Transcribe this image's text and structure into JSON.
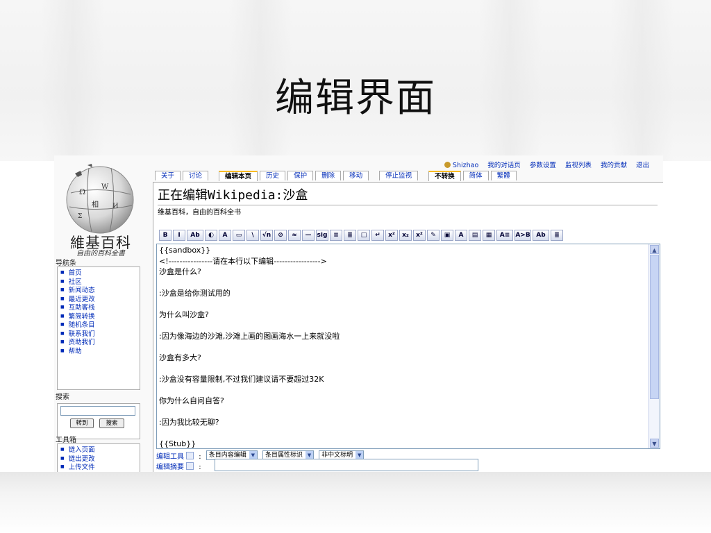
{
  "slide": {
    "title": "编辑界面"
  },
  "logo": {
    "name": "維基百科",
    "tagline": "自由的百科全書"
  },
  "personal_links": [
    "Shizhao",
    "我的对话页",
    "参数设置",
    "监视列表",
    "我的贡献",
    "退出"
  ],
  "tabs": [
    {
      "label": "关于",
      "active": false
    },
    {
      "label": "讨论",
      "active": false
    },
    {
      "label": "编辑本页",
      "active": true
    },
    {
      "label": "历史",
      "active": false
    },
    {
      "label": "保护",
      "active": false
    },
    {
      "label": "删除",
      "active": false
    },
    {
      "label": "移动",
      "active": false
    },
    {
      "label": "停止监视",
      "active": false
    },
    {
      "label": "不转换",
      "active": true
    },
    {
      "label": "简体",
      "active": false
    },
    {
      "label": "繁體",
      "active": false
    }
  ],
  "navigation": {
    "heading": "导航条",
    "items": [
      "首页",
      "社区",
      "新闻动态",
      "最近更改",
      "互助客栈",
      "繁简转换",
      "随机条目",
      "联系我们",
      "资助我们",
      "帮助"
    ]
  },
  "search": {
    "heading": "搜索",
    "go_label": "转到",
    "search_label": "搜索"
  },
  "toolbox": {
    "heading": "工具箱",
    "items": [
      "链入页面",
      "链出更改",
      "上传文件"
    ]
  },
  "page": {
    "heading": "正在编辑Wikipedia:沙盒",
    "site_sub": "维基百科，自由的百科全书"
  },
  "toolbar_buttons": [
    "B",
    "I",
    "Ab",
    "◐",
    "A",
    "▭",
    "\\",
    "√n",
    "⊘",
    "≈",
    "—",
    "sig",
    "≡",
    "≣",
    "□",
    "↵",
    "x²",
    "x₂",
    "x²",
    "✎",
    "▣",
    "A",
    "▤",
    "▦",
    "A≡",
    "A>B",
    "Ab",
    "≣"
  ],
  "editor": {
    "lines": [
      "{{sandbox}}",
      "<!----------------请在本行以下编辑----------------->",
      "沙盒是什么?",
      "",
      ":沙盒是给你测试用的",
      "",
      "为什么叫沙盒?",
      "",
      ":因为像海边的沙滩,沙滩上画的图画海水一上来就没啦",
      "",
      "沙盒有多大?",
      "",
      ":沙盒没有容量限制,不过我们建议请不要超过32K",
      "",
      "你为什么自问自答?",
      "",
      ":因为我比较无聊?",
      "",
      "{{Stub}}"
    ]
  },
  "edit_tools": {
    "label": "编辑工具",
    "colon": ":",
    "selects": [
      "条目内容编辑",
      "条目属性标识",
      "非中文标明"
    ]
  },
  "summary": {
    "label": "编辑摘要",
    "colon": ":"
  }
}
